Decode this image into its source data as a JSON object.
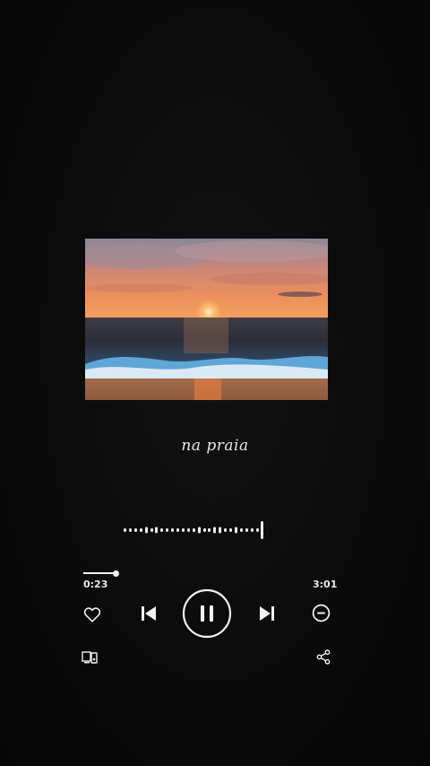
{
  "song": {
    "title": "na praia"
  },
  "player": {
    "elapsed": "0:23",
    "duration": "3:01",
    "progress_fraction": 0.13,
    "state": "playing"
  },
  "icons": {
    "like": "heart-outline-icon",
    "previous": "skip-previous-icon",
    "pause": "pause-icon",
    "next": "skip-next-icon",
    "remove": "minus-circle-icon",
    "device": "connect-device-icon",
    "share": "share-icon"
  },
  "colors": {
    "background": "#0b0b0b",
    "foreground": "#f2f2f2"
  }
}
